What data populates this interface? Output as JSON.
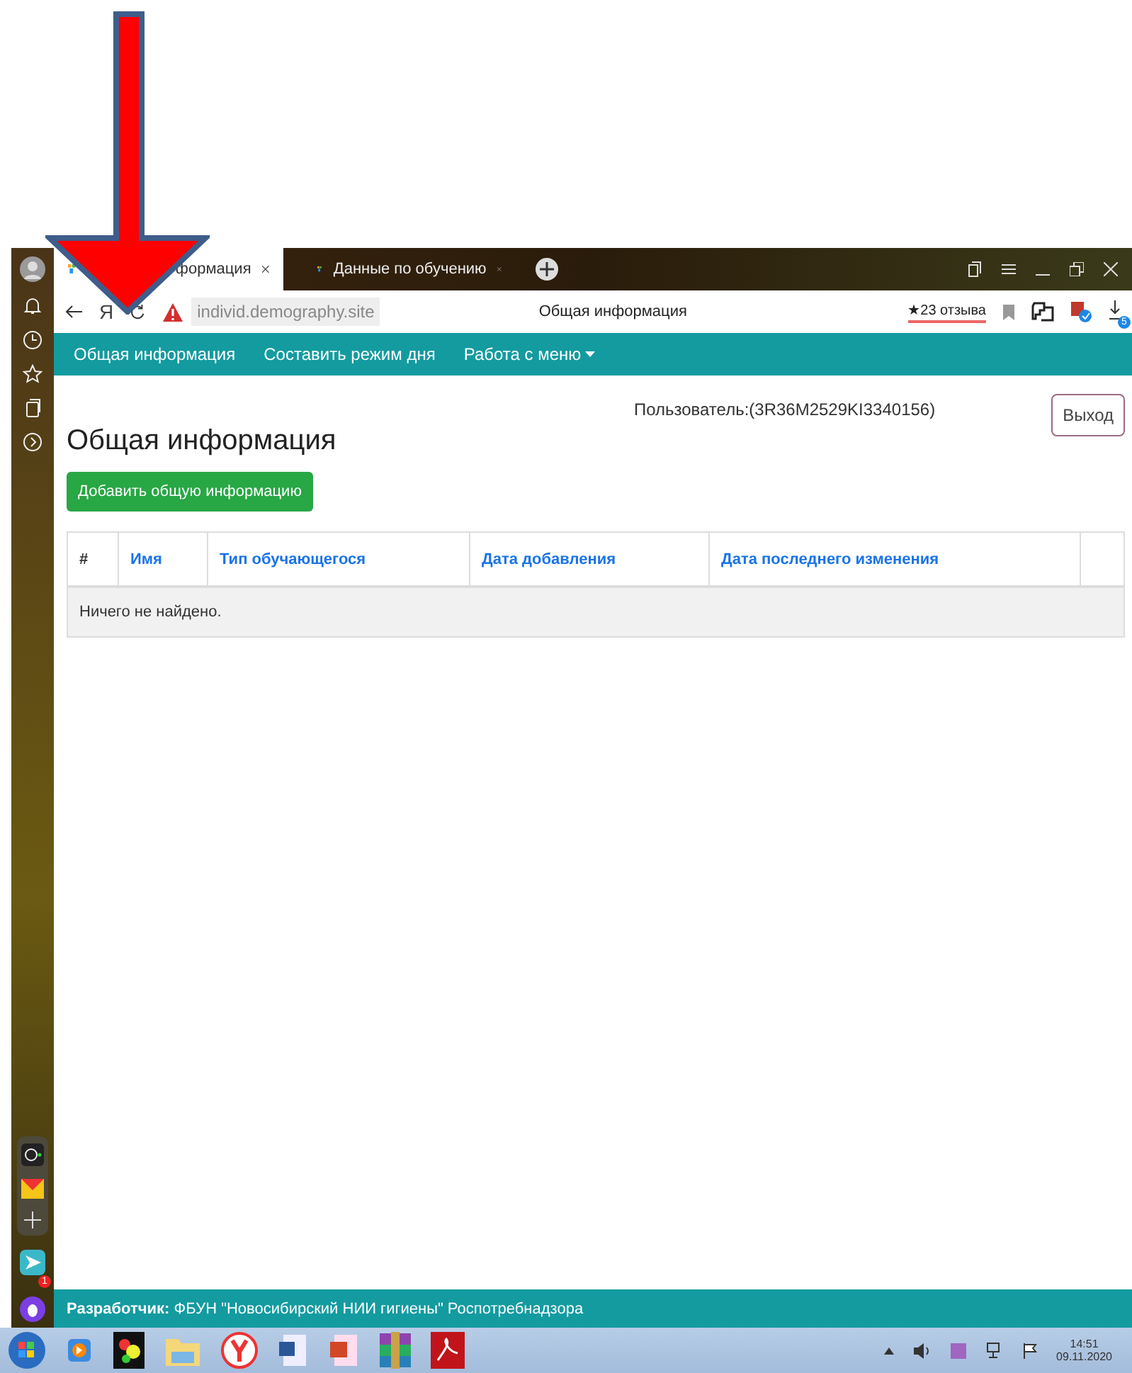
{
  "browser_tabs": [
    {
      "title": "формация",
      "selected": true
    },
    {
      "title": "Данные по обучению",
      "selected": false
    }
  ],
  "address_bar": {
    "yandex_letter": "Я",
    "url": "individ.demography.site",
    "page_title": "Общая информация",
    "reviews": "★23 отзыва",
    "downloads_badge": "5"
  },
  "nav": [
    {
      "label": "Общая информация",
      "dropdown": false
    },
    {
      "label": "Составить режим дня",
      "dropdown": false
    },
    {
      "label": "Работа с меню",
      "dropdown": true
    }
  ],
  "user": "Пользователь:(3R36M2529KI3340156)",
  "logout_button": "Выход",
  "heading": "Общая информация",
  "add_button": "Добавить общую информацию",
  "table": {
    "columns": [
      "#",
      "Имя",
      "Тип обучающегося",
      "Дата добавления",
      "Дата последнего изменения"
    ],
    "empty_message": "Ничего не найдено."
  },
  "footer": "**Разработчик:** ФБУН \"Новосибирский НИИ гигиены\" Роспотребнадзора",
  "side_panel": {
    "messenger_badge": "1"
  },
  "taskbar": {
    "time": "14:51",
    "date": "09.11.2020"
  }
}
